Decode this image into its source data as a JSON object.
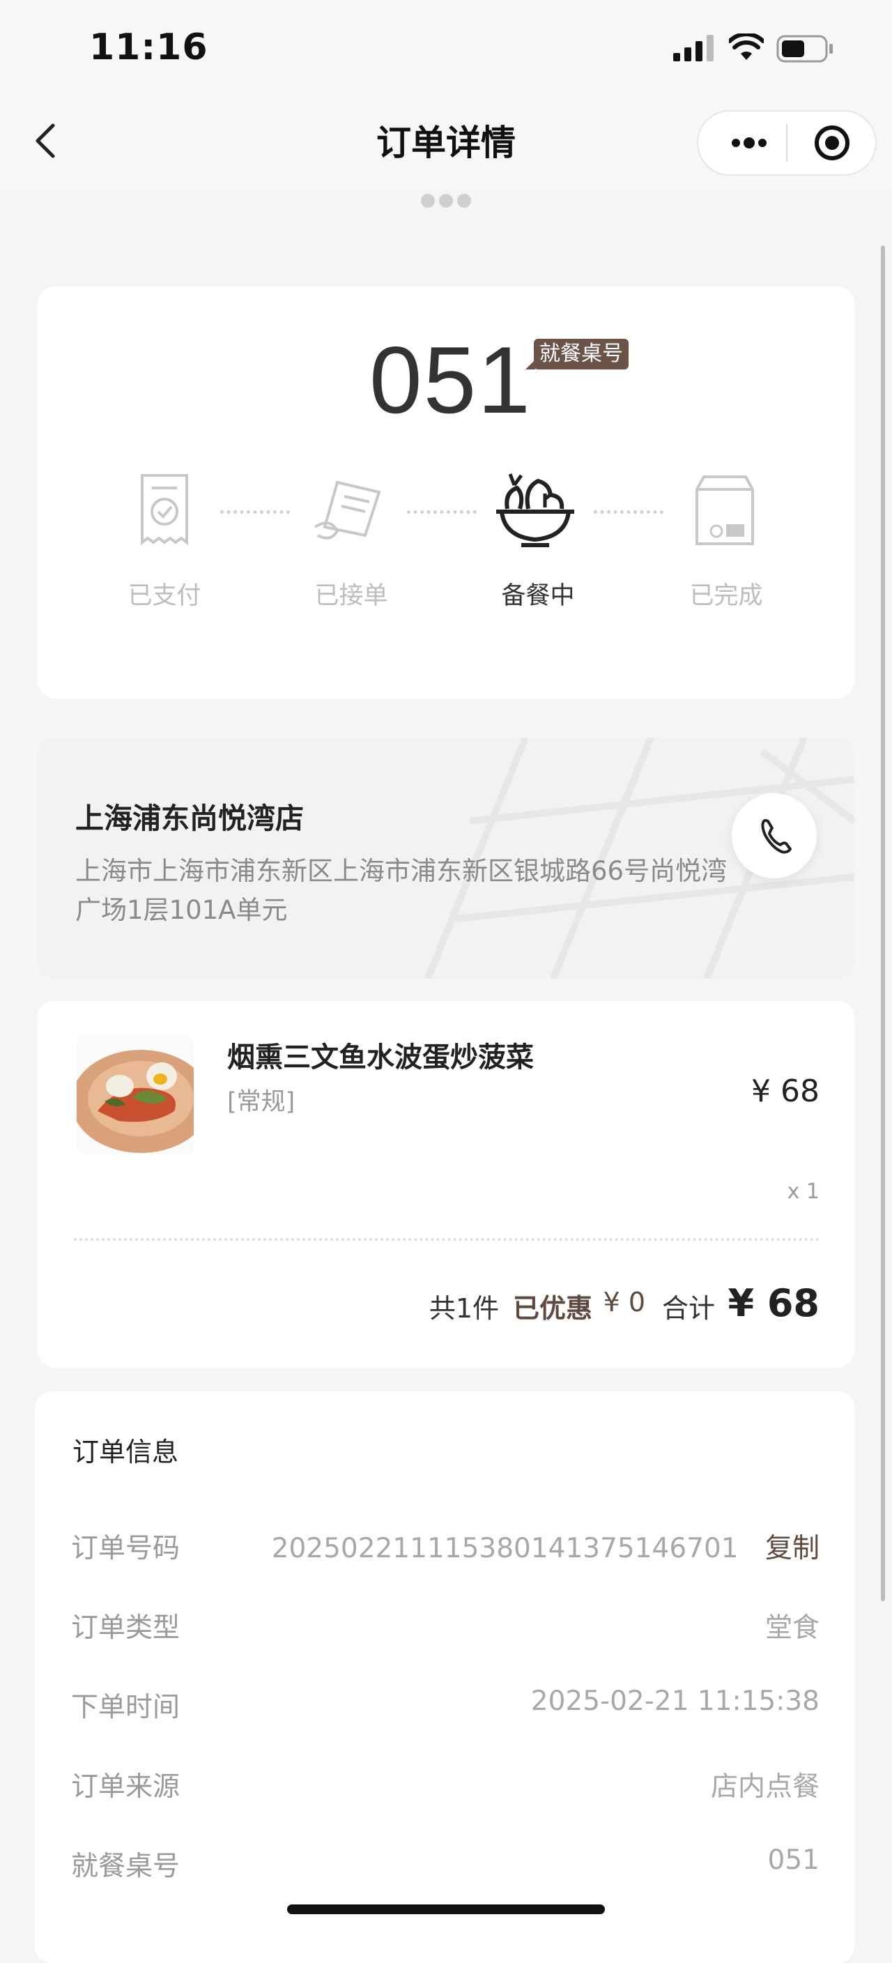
{
  "status_bar": {
    "time": "11:16"
  },
  "nav": {
    "title": "订单详情",
    "back_icon": "chevron-left-icon",
    "more_icon": "more-dots-icon",
    "close_icon": "target-icon"
  },
  "pickup": {
    "number": "051",
    "tag": "就餐桌号"
  },
  "progress": {
    "steps": [
      {
        "label": "已支付",
        "icon": "receipt-check-icon",
        "active": false
      },
      {
        "label": "已接单",
        "icon": "order-accepted-icon",
        "active": false
      },
      {
        "label": "备餐中",
        "icon": "salad-bowl-icon",
        "active": true
      },
      {
        "label": "已完成",
        "icon": "bag-complete-icon",
        "active": false
      }
    ],
    "current_step": 3
  },
  "store": {
    "name": "上海浦东尚悦湾店",
    "address": "上海市上海市浦东新区上海市浦东新区银城路66号尚悦湾广场1层101A单元",
    "phone_icon": "phone-icon"
  },
  "item": {
    "name": "烟熏三文鱼水波蛋炒菠菜",
    "spec": "[常规]",
    "price": "¥ 68",
    "qty": "x 1"
  },
  "totals": {
    "count": "共1件",
    "discount_label": "已优惠",
    "discount_value": "¥ 0",
    "total_label": "合计",
    "total_value": "¥ 68"
  },
  "order_info": {
    "title": "订单信息",
    "rows": [
      {
        "label": "订单号码",
        "value": "20250221111538014137514670​1",
        "action": "复制"
      },
      {
        "label": "订单类型",
        "value": "堂食"
      },
      {
        "label": "下单时间",
        "value": "2025-02-21 11:15:38"
      },
      {
        "label": "订单来源",
        "value": "店内点餐"
      },
      {
        "label": "就餐桌号",
        "value": "051"
      }
    ]
  },
  "colors": {
    "accent_brown": "#5e4a3e",
    "tag_bg": "#6b5347",
    "muted": "#bdbdbd"
  }
}
